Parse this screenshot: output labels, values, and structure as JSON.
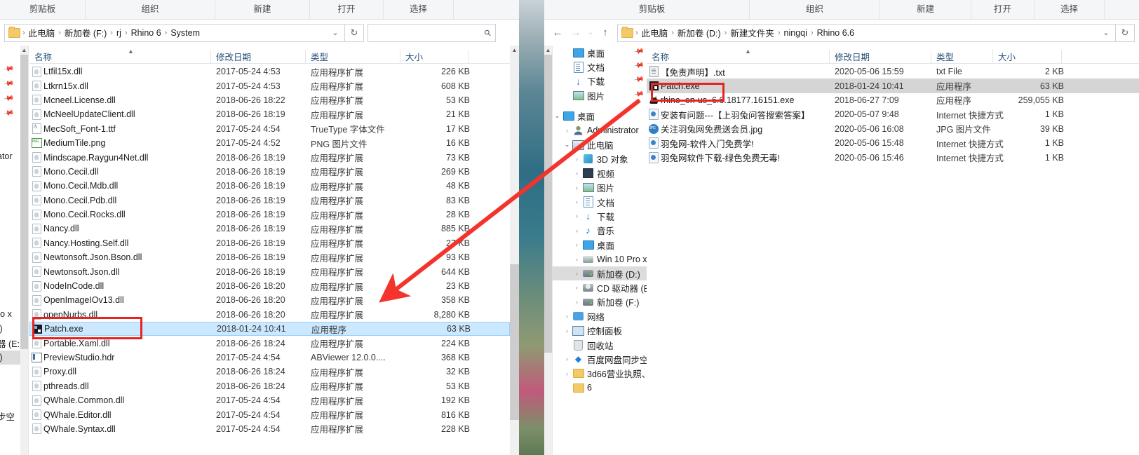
{
  "desktop": {
    "wallpaper_visible": true
  },
  "windows": {
    "left": {
      "ribbon_groups": [
        "剪贴板",
        "组织",
        "新建",
        "打开",
        "选择"
      ],
      "address": {
        "crumbs": [
          "此电脑",
          "新加卷 (F:)",
          "rj",
          "Rhino 6",
          "System"
        ],
        "refresh_label": "↻",
        "dropdown_label": "⌄"
      },
      "search": {
        "placeholder": "",
        "value": "",
        "icon": "search-icon"
      },
      "columns": [
        "名称",
        "修改日期",
        "类型",
        "大小"
      ],
      "nav_fragment": [
        "ator",
        "ro x",
        ":)",
        "器 (E:",
        "F:)",
        "步空"
      ],
      "files": [
        {
          "name": "Ltfil15x.dll",
          "date": "2017-05-24 4:53",
          "type": "应用程序扩展",
          "size": "226 KB",
          "icon": "dll-file-icon",
          "state": "normal"
        },
        {
          "name": "Ltkrn15x.dll",
          "date": "2017-05-24 4:53",
          "type": "应用程序扩展",
          "size": "608 KB",
          "icon": "dll-file-icon",
          "state": "normal"
        },
        {
          "name": "Mcneel.License.dll",
          "date": "2018-06-26 18:22",
          "type": "应用程序扩展",
          "size": "53 KB",
          "icon": "dll-file-icon",
          "state": "normal"
        },
        {
          "name": "McNeelUpdateClient.dll",
          "date": "2018-06-26 18:19",
          "type": "应用程序扩展",
          "size": "21 KB",
          "icon": "dll-file-icon",
          "state": "normal"
        },
        {
          "name": "MecSoft_Font-1.ttf",
          "date": "2017-05-24 4:54",
          "type": "TrueType 字体文件",
          "size": "17 KB",
          "icon": "truetype-font-icon",
          "state": "normal"
        },
        {
          "name": "MediumTile.png",
          "date": "2017-05-24 4:52",
          "type": "PNG 图片文件",
          "size": "16 KB",
          "icon": "png-image-icon",
          "state": "normal"
        },
        {
          "name": "Mindscape.Raygun4Net.dll",
          "date": "2018-06-26 18:19",
          "type": "应用程序扩展",
          "size": "73 KB",
          "icon": "dll-file-icon",
          "state": "normal"
        },
        {
          "name": "Mono.Cecil.dll",
          "date": "2018-06-26 18:19",
          "type": "应用程序扩展",
          "size": "269 KB",
          "icon": "dll-file-icon",
          "state": "normal"
        },
        {
          "name": "Mono.Cecil.Mdb.dll",
          "date": "2018-06-26 18:19",
          "type": "应用程序扩展",
          "size": "48 KB",
          "icon": "dll-file-icon",
          "state": "normal"
        },
        {
          "name": "Mono.Cecil.Pdb.dll",
          "date": "2018-06-26 18:19",
          "type": "应用程序扩展",
          "size": "83 KB",
          "icon": "dll-file-icon",
          "state": "normal"
        },
        {
          "name": "Mono.Cecil.Rocks.dll",
          "date": "2018-06-26 18:19",
          "type": "应用程序扩展",
          "size": "28 KB",
          "icon": "dll-file-icon",
          "state": "normal"
        },
        {
          "name": "Nancy.dll",
          "date": "2018-06-26 18:19",
          "type": "应用程序扩展",
          "size": "885 KB",
          "icon": "dll-file-icon",
          "state": "normal"
        },
        {
          "name": "Nancy.Hosting.Self.dll",
          "date": "2018-06-26 18:19",
          "type": "应用程序扩展",
          "size": "27 KB",
          "icon": "dll-file-icon",
          "state": "normal"
        },
        {
          "name": "Newtonsoft.Json.Bson.dll",
          "date": "2018-06-26 18:19",
          "type": "应用程序扩展",
          "size": "93 KB",
          "icon": "dll-file-icon",
          "state": "normal"
        },
        {
          "name": "Newtonsoft.Json.dll",
          "date": "2018-06-26 18:19",
          "type": "应用程序扩展",
          "size": "644 KB",
          "icon": "dll-file-icon",
          "state": "normal"
        },
        {
          "name": "NodeInCode.dll",
          "date": "2018-06-26 18:20",
          "type": "应用程序扩展",
          "size": "23 KB",
          "icon": "dll-file-icon",
          "state": "normal"
        },
        {
          "name": "OpenImageIOv13.dll",
          "date": "2018-06-26 18:20",
          "type": "应用程序扩展",
          "size": "358 KB",
          "icon": "dll-file-icon",
          "state": "normal"
        },
        {
          "name": "openNurbs.dll",
          "date": "2018-06-26 18:20",
          "type": "应用程序扩展",
          "size": "8,280 KB",
          "icon": "dll-file-icon",
          "state": "normal"
        },
        {
          "name": "Patch.exe",
          "date": "2018-01-24 10:41",
          "type": "应用程序",
          "size": "63 KB",
          "icon": "patch-exe-icon",
          "state": "selected-blue"
        },
        {
          "name": "Portable.Xaml.dll",
          "date": "2018-06-26 18:24",
          "type": "应用程序扩展",
          "size": "224 KB",
          "icon": "dll-file-icon",
          "state": "normal"
        },
        {
          "name": "PreviewStudio.hdr",
          "date": "2017-05-24 4:54",
          "type": "ABViewer 12.0.0....",
          "size": "368 KB",
          "icon": "hdr-file-icon",
          "state": "normal"
        },
        {
          "name": "Proxy.dll",
          "date": "2018-06-26 18:24",
          "type": "应用程序扩展",
          "size": "32 KB",
          "icon": "dll-file-icon",
          "state": "normal"
        },
        {
          "name": "pthreads.dll",
          "date": "2018-06-26 18:24",
          "type": "应用程序扩展",
          "size": "53 KB",
          "icon": "dll-file-icon",
          "state": "normal"
        },
        {
          "name": "QWhale.Common.dll",
          "date": "2017-05-24 4:54",
          "type": "应用程序扩展",
          "size": "192 KB",
          "icon": "dll-file-icon",
          "state": "normal"
        },
        {
          "name": "QWhale.Editor.dll",
          "date": "2017-05-24 4:54",
          "type": "应用程序扩展",
          "size": "816 KB",
          "icon": "dll-file-icon",
          "state": "normal"
        },
        {
          "name": "QWhale.Syntax.dll",
          "date": "2017-05-24 4:54",
          "type": "应用程序扩展",
          "size": "228 KB",
          "icon": "dll-file-icon",
          "state": "normal"
        }
      ]
    },
    "right": {
      "ribbon_groups": [
        "剪贴板",
        "组织",
        "新建",
        "打开",
        "选择"
      ],
      "address": {
        "crumbs": [
          "此电脑",
          "新加卷 (D:)",
          "新建文件夹",
          "ningqi",
          "Rhino 6.6"
        ],
        "back_label": "←",
        "forward_label": "→",
        "recent_label": "⌄",
        "up_label": "↑",
        "refresh_label": "↻",
        "dropdown_label": "⌄"
      },
      "columns": [
        "名称",
        "修改日期",
        "类型",
        "大小"
      ],
      "nav_items": [
        {
          "label": "桌面",
          "icon": "desktop-icon",
          "indent": 1,
          "chev": "",
          "pinned": true,
          "selected": false
        },
        {
          "label": "文档",
          "icon": "documents-icon",
          "indent": 1,
          "chev": "",
          "pinned": true,
          "selected": false
        },
        {
          "label": "下载",
          "icon": "downloads-icon",
          "indent": 1,
          "chev": "",
          "pinned": true,
          "selected": false
        },
        {
          "label": "图片",
          "icon": "pictures-icon",
          "indent": 1,
          "chev": "",
          "pinned": true,
          "selected": false
        },
        {
          "label": "__GAP__",
          "icon": "",
          "indent": 0,
          "chev": "",
          "pinned": false,
          "selected": false
        },
        {
          "label": "桌面",
          "icon": "desktop-icon",
          "indent": 0,
          "chev": "open",
          "pinned": false,
          "selected": false
        },
        {
          "label": "Administrator",
          "icon": "user-icon",
          "indent": 1,
          "chev": "closed",
          "pinned": false,
          "selected": false
        },
        {
          "label": "此电脑",
          "icon": "this-pc-icon",
          "indent": 1,
          "chev": "open",
          "pinned": false,
          "selected": false
        },
        {
          "label": "3D 对象",
          "icon": "3d-objects-icon",
          "indent": 2,
          "chev": "closed",
          "pinned": false,
          "selected": false
        },
        {
          "label": "视频",
          "icon": "videos-icon",
          "indent": 2,
          "chev": "closed",
          "pinned": false,
          "selected": false
        },
        {
          "label": "图片",
          "icon": "pictures-icon",
          "indent": 2,
          "chev": "closed",
          "pinned": false,
          "selected": false
        },
        {
          "label": "文档",
          "icon": "documents-icon",
          "indent": 2,
          "chev": "closed",
          "pinned": false,
          "selected": false
        },
        {
          "label": "下载",
          "icon": "downloads-icon",
          "indent": 2,
          "chev": "closed",
          "pinned": false,
          "selected": false
        },
        {
          "label": "音乐",
          "icon": "music-icon",
          "indent": 2,
          "chev": "closed",
          "pinned": false,
          "selected": false
        },
        {
          "label": "桌面",
          "icon": "desktop-icon",
          "indent": 2,
          "chev": "closed",
          "pinned": false,
          "selected": false
        },
        {
          "label": "Win 10 Pro x",
          "icon": "system-drive-icon",
          "indent": 2,
          "chev": "closed",
          "pinned": false,
          "selected": false
        },
        {
          "label": "新加卷 (D:)",
          "icon": "drive-icon",
          "indent": 2,
          "chev": "closed",
          "pinned": false,
          "selected": true
        },
        {
          "label": "CD 驱动器 (E:",
          "icon": "cd-drive-icon",
          "indent": 2,
          "chev": "closed",
          "pinned": false,
          "selected": false
        },
        {
          "label": "新加卷 (F:)",
          "icon": "drive-icon",
          "indent": 2,
          "chev": "closed",
          "pinned": false,
          "selected": false
        },
        {
          "label": "网络",
          "icon": "network-icon",
          "indent": 1,
          "chev": "closed",
          "pinned": false,
          "selected": false
        },
        {
          "label": "控制面板",
          "icon": "control-panel-icon",
          "indent": 1,
          "chev": "closed",
          "pinned": false,
          "selected": false
        },
        {
          "label": "回收站",
          "icon": "recycle-bin-icon",
          "indent": 1,
          "chev": "",
          "pinned": false,
          "selected": false
        },
        {
          "label": "百度网盘同步空",
          "icon": "baidu-netdisk-icon",
          "indent": 1,
          "chev": "closed",
          "pinned": false,
          "selected": false
        },
        {
          "label": "3d66营业执照、",
          "icon": "folder-icon",
          "indent": 1,
          "chev": "closed",
          "pinned": false,
          "selected": false
        },
        {
          "label": "6",
          "icon": "folder-icon",
          "indent": 1,
          "chev": "",
          "pinned": false,
          "selected": false
        }
      ],
      "files": [
        {
          "name": "【免责声明】.txt",
          "date": "2020-05-06 15:59",
          "type": "txt File",
          "size": "2 KB",
          "icon": "txt-file-icon",
          "state": "normal"
        },
        {
          "name": "Patch.exe",
          "date": "2018-01-24 10:41",
          "type": "应用程序",
          "size": "63 KB",
          "icon": "patch-exe-icon",
          "state": "selected-grey"
        },
        {
          "name": "rhino_en-us_6.6.18177.16151.exe",
          "date": "2018-06-27 7:09",
          "type": "应用程序",
          "size": "259,055 KB",
          "icon": "rhino-exe-icon",
          "state": "normal"
        },
        {
          "name": "安装有问题---【上羽兔问答搜索答案】",
          "date": "2020-05-07 9:48",
          "type": "Internet 快捷方式",
          "size": "1 KB",
          "icon": "internet-shortcut-icon",
          "state": "normal"
        },
        {
          "name": "关注羽兔网免费送会员.jpg",
          "date": "2020-05-06 16:08",
          "type": "JPG 图片文件",
          "size": "39 KB",
          "icon": "jpg-image-icon",
          "state": "normal"
        },
        {
          "name": "羽兔网-软件入门免费学!",
          "date": "2020-05-06 15:48",
          "type": "Internet 快捷方式",
          "size": "1 KB",
          "icon": "internet-shortcut-icon",
          "state": "normal"
        },
        {
          "name": "羽兔网软件下载-绿色免费无毒!",
          "date": "2020-05-06 15:46",
          "type": "Internet 快捷方式",
          "size": "1 KB",
          "icon": "internet-shortcut-icon",
          "state": "normal"
        }
      ]
    }
  },
  "annotations": {
    "accent_red": "#e8231f",
    "highlight_left": {
      "target": "Patch.exe"
    },
    "highlight_right": {
      "target": "Patch.exe"
    },
    "arrow": {
      "from": "right-window Patch.exe",
      "to": "left-window Patch.exe"
    }
  }
}
